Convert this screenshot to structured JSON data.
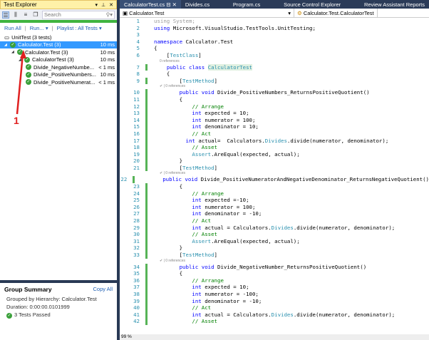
{
  "test_explorer": {
    "title": "Test Explorer",
    "search_placeholder": "Search",
    "run_all": "Run All",
    "run": "Run...",
    "playlist": "Playlist : All Tests",
    "progress_percent": 100,
    "tree": [
      {
        "name": "UnitTest (3 tests)",
        "duration": "",
        "level": 0,
        "kind": "root"
      },
      {
        "name": "Calculator.Test (3)",
        "duration": "10 ms",
        "level": 0,
        "selected": true
      },
      {
        "name": "Calculator.Test (3)",
        "duration": "10 ms",
        "level": 1
      },
      {
        "name": "CalculatorTest (3)",
        "duration": "10 ms",
        "level": 2
      },
      {
        "name": "Divide_NegativeNumbe...",
        "duration": "< 1 ms",
        "level": 3
      },
      {
        "name": "Divide_PositiveNumbers...",
        "duration": "10 ms",
        "level": 3
      },
      {
        "name": "Divide_PositiveNumerat...",
        "duration": "< 1 ms",
        "level": 3
      }
    ],
    "annotation": "1"
  },
  "summary": {
    "title": "Group Summary",
    "copy_all": "Copy All",
    "grouped": "Grouped by Hierarchy: Calculator.Test",
    "duration": "Duration: 0:00:00.0101999",
    "passed": "3 Tests Passed"
  },
  "tabs": [
    "CalculatorTest.cs",
    "Divides.cs",
    "Program.cs",
    "Source Control Explorer",
    "Review Assistant Reports"
  ],
  "nav": {
    "project": "Calculator.Test",
    "member": "Calculator.Test.CalculatorTest"
  },
  "zoom": "99 %",
  "code": [
    {
      "n": 1,
      "s": [
        [
          "using System;",
          "gr"
        ]
      ]
    },
    {
      "n": 2,
      "s": [
        [
          "using ",
          "kw"
        ],
        [
          "Microsoft.VisualStudio.TestTools.UnitTesting;",
          ""
        ]
      ]
    },
    {
      "n": 3,
      "s": []
    },
    {
      "n": 4,
      "s": [
        [
          "namespace ",
          "kw"
        ],
        [
          "Calculator.Test",
          ""
        ]
      ]
    },
    {
      "n": 5,
      "s": [
        [
          "{",
          ""
        ]
      ]
    },
    {
      "n": 6,
      "s": [
        [
          "    [",
          ""
        ],
        [
          "TestClass",
          "ty"
        ],
        [
          "]",
          ""
        ]
      ]
    },
    {
      "lens": "0 references"
    },
    {
      "n": 7,
      "g": true,
      "s": [
        [
          "    ",
          ""
        ],
        [
          "public class ",
          "kw"
        ],
        [
          "CalculatorTest",
          "hl"
        ]
      ]
    },
    {
      "n": 8,
      "s": [
        [
          "    {",
          ""
        ]
      ]
    },
    {
      "n": 9,
      "g": true,
      "s": [
        [
          "        [",
          ""
        ],
        [
          "TestMethod",
          "ty"
        ],
        [
          "]",
          ""
        ]
      ]
    },
    {
      "lens": "✔ | 0 references"
    },
    {
      "n": 10,
      "g": true,
      "s": [
        [
          "        ",
          ""
        ],
        [
          "public void ",
          "kw"
        ],
        [
          "Divide_PositiveNumbers_ReturnsPositiveQuotient()",
          ""
        ]
      ]
    },
    {
      "n": 11,
      "g": true,
      "s": [
        [
          "        {",
          ""
        ]
      ]
    },
    {
      "n": 12,
      "g": true,
      "s": [
        [
          "            // Arrange",
          "cm"
        ]
      ]
    },
    {
      "n": 13,
      "g": true,
      "s": [
        [
          "            ",
          ""
        ],
        [
          "int ",
          "kw"
        ],
        [
          "expected = 10;",
          ""
        ]
      ]
    },
    {
      "n": 14,
      "g": true,
      "s": [
        [
          "            ",
          ""
        ],
        [
          "int ",
          "kw"
        ],
        [
          "numerator = 100;",
          ""
        ]
      ]
    },
    {
      "n": 15,
      "g": true,
      "s": [
        [
          "            ",
          ""
        ],
        [
          "int ",
          "kw"
        ],
        [
          "denominator = 10;",
          ""
        ]
      ]
    },
    {
      "n": 16,
      "g": true,
      "s": [
        [
          "            // Act",
          "cm"
        ]
      ]
    },
    {
      "n": 17,
      "g": true,
      "s": [
        [
          "          ",
          ""
        ],
        [
          "int ",
          "kw"
        ],
        [
          "actual=  Calculators.",
          ""
        ],
        [
          "Divides",
          "ty"
        ],
        [
          ".divide(numerator, denominator);",
          ""
        ]
      ]
    },
    {
      "n": 18,
      "g": true,
      "s": [
        [
          "            // Asset",
          "cm"
        ]
      ]
    },
    {
      "n": 19,
      "g": true,
      "s": [
        [
          "            ",
          ""
        ],
        [
          "Assert",
          "ty"
        ],
        [
          ".AreEqual(expected, actual);",
          ""
        ]
      ]
    },
    {
      "n": 20,
      "g": true,
      "s": [
        [
          "        }",
          ""
        ]
      ]
    },
    {
      "n": 21,
      "g": true,
      "s": [
        [
          "        [",
          ""
        ],
        [
          "TestMethod",
          "ty"
        ],
        [
          "]",
          ""
        ]
      ]
    },
    {
      "lens": "✔ | 0 references"
    },
    {
      "n": 22,
      "g": true,
      "s": [
        [
          "        ",
          ""
        ],
        [
          "public void ",
          "kw"
        ],
        [
          "Divide_PositiveNumeratorAndNegativeDenominator_ReturnsNegativeQuotient()",
          ""
        ]
      ]
    },
    {
      "n": 23,
      "g": true,
      "s": [
        [
          "        {",
          ""
        ]
      ]
    },
    {
      "n": 24,
      "g": true,
      "s": [
        [
          "            // Arrange",
          "cm"
        ]
      ]
    },
    {
      "n": 25,
      "g": true,
      "s": [
        [
          "            ",
          ""
        ],
        [
          "int ",
          "kw"
        ],
        [
          "expected =-10;",
          ""
        ]
      ]
    },
    {
      "n": 26,
      "g": true,
      "s": [
        [
          "            ",
          ""
        ],
        [
          "int ",
          "kw"
        ],
        [
          "numerator = 100;",
          ""
        ]
      ]
    },
    {
      "n": 27,
      "g": true,
      "s": [
        [
          "            ",
          ""
        ],
        [
          "int ",
          "kw"
        ],
        [
          "denominator = -10;",
          ""
        ]
      ]
    },
    {
      "n": 28,
      "g": true,
      "s": [
        [
          "            // Act",
          "cm"
        ]
      ]
    },
    {
      "n": 29,
      "g": true,
      "s": [
        [
          "            ",
          ""
        ],
        [
          "int ",
          "kw"
        ],
        [
          "actual = Calculators.",
          ""
        ],
        [
          "Divides",
          "ty"
        ],
        [
          ".divide(numerator, denominator);",
          ""
        ]
      ]
    },
    {
      "n": 30,
      "g": true,
      "s": [
        [
          "            // Asset",
          "cm"
        ]
      ]
    },
    {
      "n": 31,
      "g": true,
      "s": [
        [
          "            ",
          ""
        ],
        [
          "Assert",
          "ty"
        ],
        [
          ".AreEqual(expected, actual);",
          ""
        ]
      ]
    },
    {
      "n": 32,
      "g": true,
      "s": [
        [
          "        }",
          ""
        ]
      ]
    },
    {
      "n": 33,
      "g": true,
      "s": [
        [
          "        [",
          ""
        ],
        [
          "TestMethod",
          "ty"
        ],
        [
          "]",
          ""
        ]
      ]
    },
    {
      "lens": "✔ | 0 references"
    },
    {
      "n": 34,
      "g": true,
      "s": [
        [
          "        ",
          ""
        ],
        [
          "public void ",
          "kw"
        ],
        [
          "Divide_NegativeNumber_ReturnsPositiveQuotient()",
          ""
        ]
      ]
    },
    {
      "n": 35,
      "g": true,
      "s": [
        [
          "        {",
          ""
        ]
      ]
    },
    {
      "n": 36,
      "g": true,
      "s": [
        [
          "            // Arrange",
          "cm"
        ]
      ]
    },
    {
      "n": 37,
      "g": true,
      "s": [
        [
          "            ",
          ""
        ],
        [
          "int ",
          "kw"
        ],
        [
          "expected = 10;",
          ""
        ]
      ]
    },
    {
      "n": 38,
      "g": true,
      "s": [
        [
          "            ",
          ""
        ],
        [
          "int ",
          "kw"
        ],
        [
          "numerator = -100;",
          ""
        ]
      ]
    },
    {
      "n": 39,
      "g": true,
      "s": [
        [
          "            ",
          ""
        ],
        [
          "int ",
          "kw"
        ],
        [
          "denominator = -10;",
          ""
        ]
      ]
    },
    {
      "n": 40,
      "g": true,
      "s": [
        [
          "            // Act",
          "cm"
        ]
      ]
    },
    {
      "n": 41,
      "g": true,
      "s": [
        [
          "            ",
          ""
        ],
        [
          "int ",
          "kw"
        ],
        [
          "actual = Calculators.",
          ""
        ],
        [
          "Divides",
          "ty"
        ],
        [
          ".divide(numerator, denominator);",
          ""
        ]
      ]
    },
    {
      "n": 42,
      "g": true,
      "s": [
        [
          "            // Asset",
          "cm"
        ]
      ]
    }
  ]
}
